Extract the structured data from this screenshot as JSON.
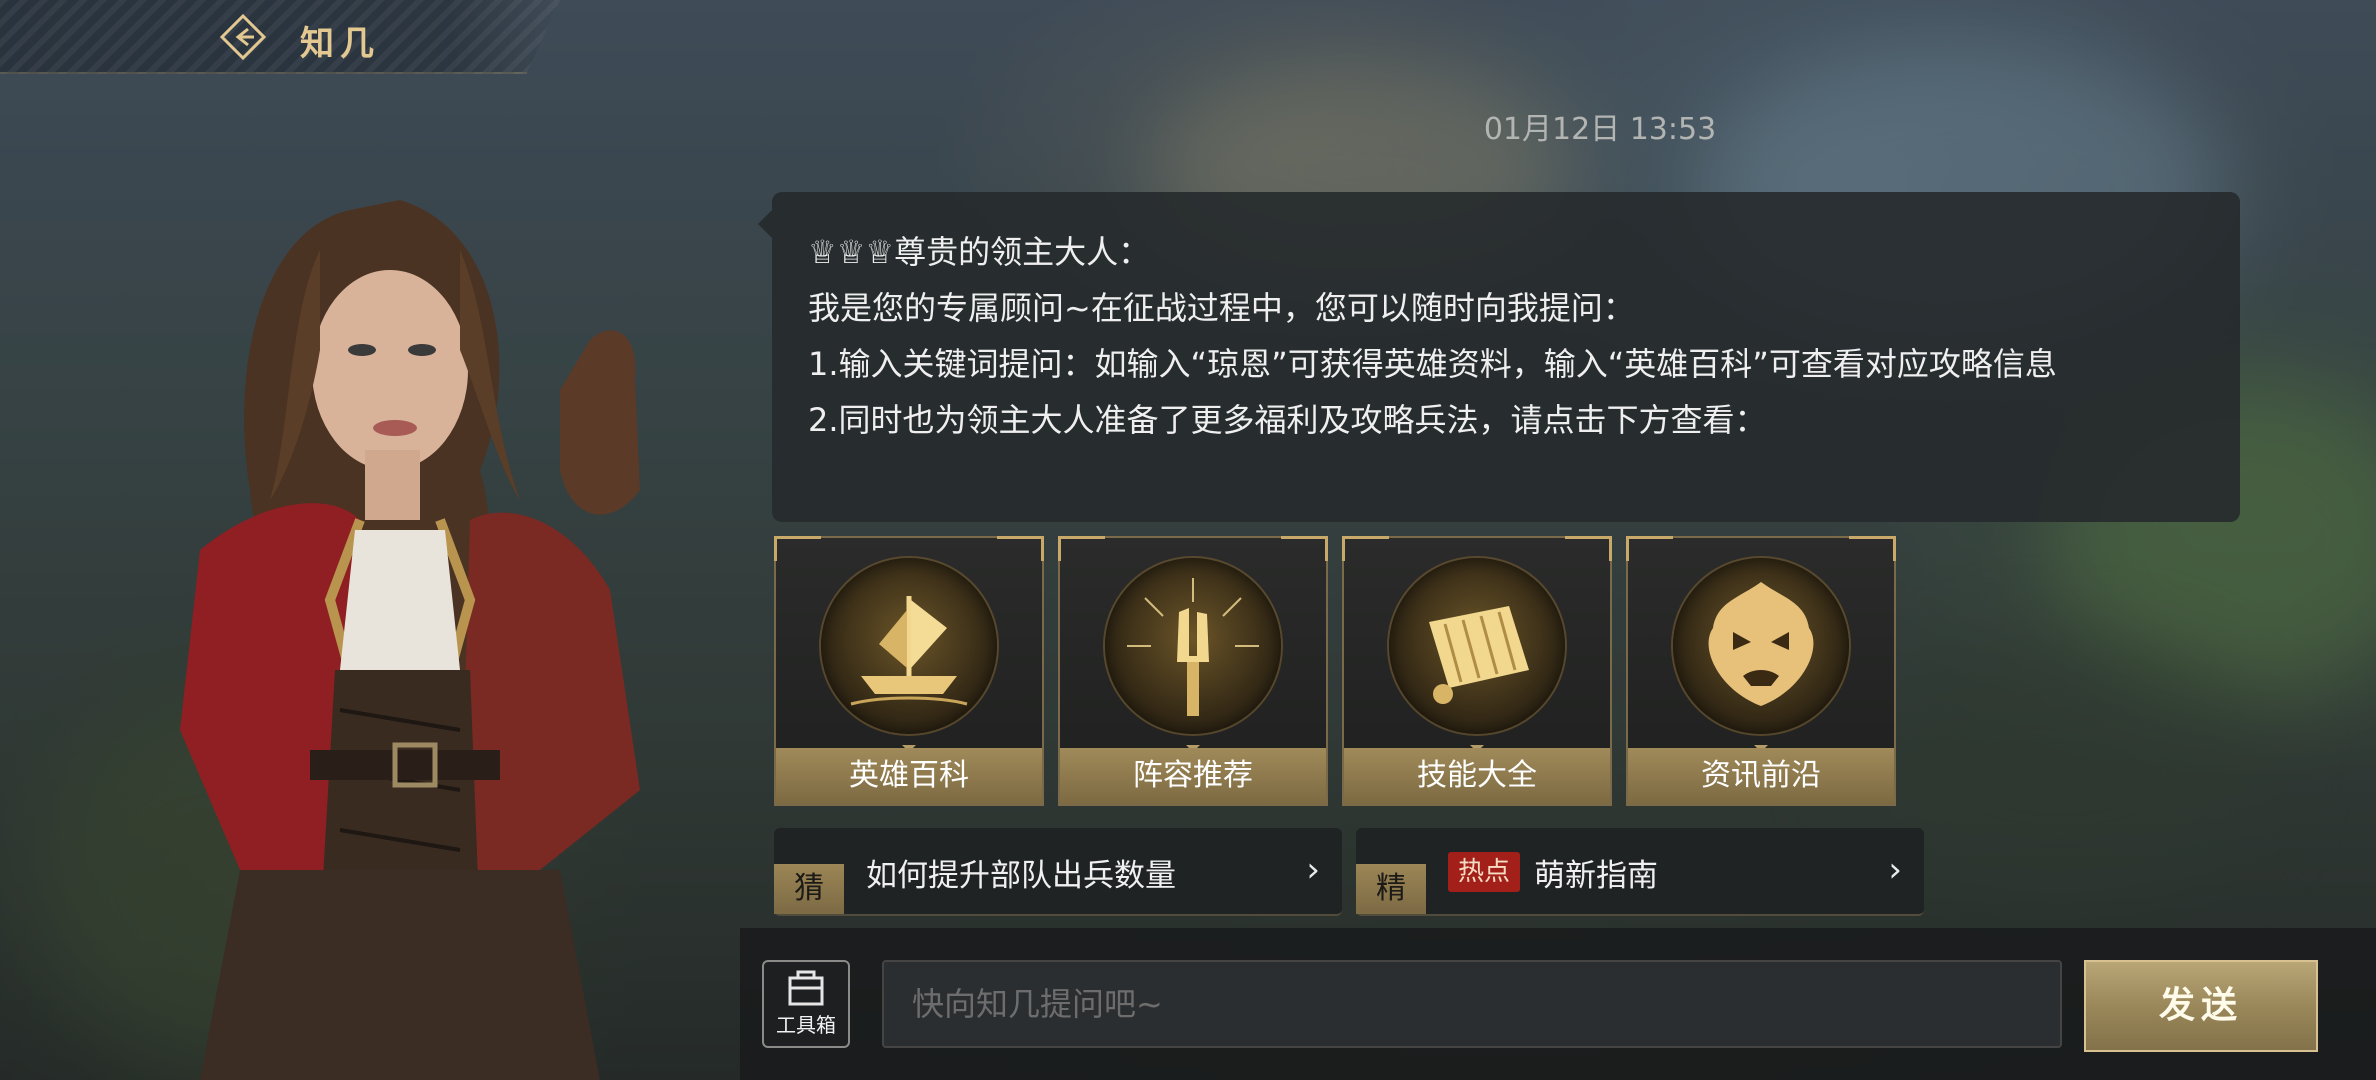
{
  "header": {
    "back_icon": "back-arrow-icon",
    "title": "知几"
  },
  "chat": {
    "timestamp": "01月12日 13:53",
    "message": {
      "greeting": "♕♕♕尊贵的领主大人：",
      "line1": "我是您的专属顾问~在征战过程中，您可以随时向我提问：",
      "line2": "1.输入关键词提问：如输入“琼恩”可获得英雄资料，输入“英雄百科”可查看对应攻略信息",
      "line3": "2.同时也为领主大人准备了更多福利及攻略兵法，请点击下方查看："
    }
  },
  "cards": [
    {
      "label": "英雄百科",
      "icon": "ship-icon"
    },
    {
      "label": "阵容推荐",
      "icon": "torch-hand-icon"
    },
    {
      "label": "技能大全",
      "icon": "scroll-icon"
    },
    {
      "label": "资讯前沿",
      "icon": "fire-mask-icon"
    }
  ],
  "suggestions": [
    {
      "tag": "猜",
      "text": "如何提升部队出兵数量",
      "hot": ""
    },
    {
      "tag": "精",
      "text": "萌新指南",
      "hot": "热点"
    }
  ],
  "input_bar": {
    "toolbox_label": "工具箱",
    "toolbox_icon": "toolbox-icon",
    "placeholder": "快向知几提问吧~",
    "send_label": "发送"
  },
  "colors": {
    "accent_gold": "#c9a96a",
    "title_gold": "#e3c891",
    "hot_red": "#a21f1a",
    "bubble_bg": "#262a2c"
  }
}
